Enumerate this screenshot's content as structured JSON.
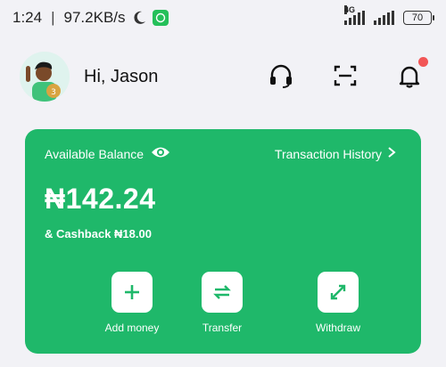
{
  "status_bar": {
    "time": "1:24",
    "separator": "|",
    "speed": "97.2KB/s",
    "network_label": "4G",
    "battery": "70"
  },
  "header": {
    "greeting": "Hi, Jason"
  },
  "card": {
    "available_label": "Available Balance",
    "history_label": "Transaction History",
    "balance": "₦142.24",
    "cashback": "& Cashback ₦18.00",
    "actions": [
      {
        "label": "Add money",
        "icon": "plus-icon"
      },
      {
        "label": "Transfer",
        "icon": "transfer-icon"
      },
      {
        "label": "Withdraw",
        "icon": "expand-icon"
      }
    ]
  },
  "colors": {
    "accent": "#1fb86a",
    "background": "#f2f2f6",
    "notification": "#f25656"
  }
}
